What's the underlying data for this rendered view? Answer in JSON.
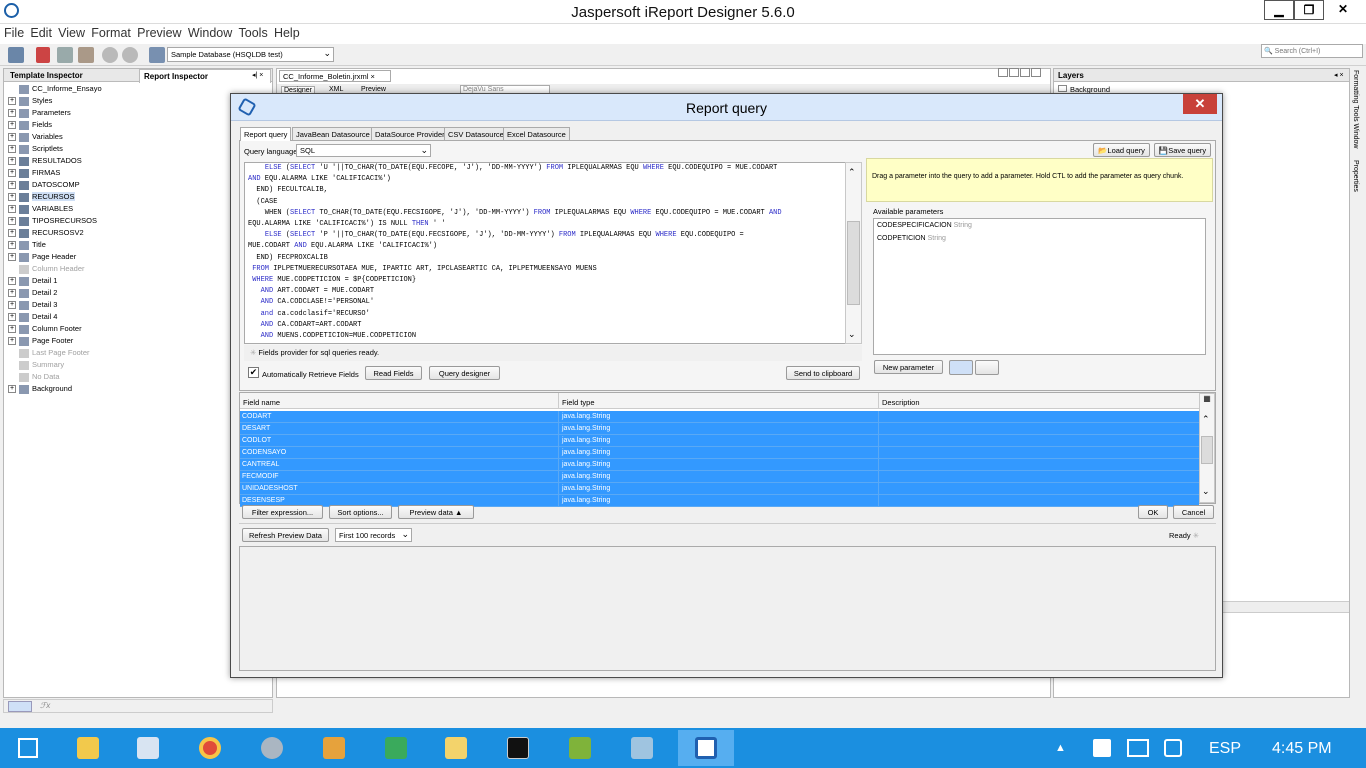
{
  "window": {
    "title": "Jaspersoft iReport Designer 5.6.0"
  },
  "menu": [
    "File",
    "Edit",
    "View",
    "Format",
    "Preview",
    "Window",
    "Tools",
    "Help"
  ],
  "toolbar": {
    "datasource": "Sample Database (HSQLDB test)",
    "search_placeholder": "Search (Ctrl+I)"
  },
  "left_panel": {
    "tabs": [
      "Template Inspector",
      "Report Inspector"
    ],
    "tree": [
      {
        "label": "CC_Informe_Ensayo",
        "dim": false
      },
      {
        "label": "Styles",
        "dim": false
      },
      {
        "label": "Parameters",
        "dim": false
      },
      {
        "label": "Fields",
        "dim": false
      },
      {
        "label": "Variables",
        "dim": false
      },
      {
        "label": "Scriptlets",
        "dim": false
      },
      {
        "label": "RESULTADOS",
        "dim": false
      },
      {
        "label": "FIRMAS",
        "dim": false
      },
      {
        "label": "DATOSCOMP",
        "dim": false
      },
      {
        "label": "RECURSOS",
        "dim": false
      },
      {
        "label": "VARIABLES",
        "dim": false
      },
      {
        "label": "TIPOSRECURSOS",
        "dim": false
      },
      {
        "label": "RECURSOSV2",
        "dim": false
      },
      {
        "label": "Title",
        "dim": false
      },
      {
        "label": "Page Header",
        "dim": false
      },
      {
        "label": "Column Header",
        "dim": true
      },
      {
        "label": "Detail 1",
        "dim": false
      },
      {
        "label": "Detail 2",
        "dim": false
      },
      {
        "label": "Detail 3",
        "dim": false
      },
      {
        "label": "Detail 4",
        "dim": false
      },
      {
        "label": "Column Footer",
        "dim": false
      },
      {
        "label": "Page Footer",
        "dim": false
      },
      {
        "label": "Last Page Footer",
        "dim": true
      },
      {
        "label": "Summary",
        "dim": true
      },
      {
        "label": "No Data",
        "dim": true
      },
      {
        "label": "Background",
        "dim": false
      }
    ]
  },
  "editor": {
    "file_tab": "CC_Informe_Boletin.jrxml",
    "view_tabs": [
      "Designer",
      "XML",
      "Preview"
    ],
    "font": "DejaVu Sans"
  },
  "right_panel": {
    "title": "Layers",
    "item": "Background"
  },
  "side_labels": [
    "Formatting Tools Window",
    "Properties"
  ],
  "dialog": {
    "title": "Report query",
    "tabs": [
      "Report query",
      "JavaBean Datasource",
      "DataSource Provider",
      "CSV Datasource",
      "Excel Datasource"
    ],
    "query_language_label": "Query language",
    "query_language": "SQL",
    "load_query": "Load query",
    "save_query": "Save query",
    "sql_lines": [
      "    ELSE (SELECT 'U '||TO_CHAR(TO_DATE(EQU.FECOPE, 'J'), 'DD-MM-YYYY') FROM IPLEQUALARMAS EQU WHERE EQU.CODEQUIPO = MUE.CODART",
      "AND EQU.ALARMA LIKE 'CALIFICACI%')",
      "  END) FECULTCALIB,",
      "  (CASE",
      "    WHEN (SELECT TO_CHAR(TO_DATE(EQU.FECSIGOPE, 'J'), 'DD-MM-YYYY') FROM IPLEQUALARMAS EQU WHERE EQU.CODEQUIPO = MUE.CODART AND",
      "EQU.ALARMA LIKE 'CALIFICACI%') IS NULL THEN ' '",
      "    ELSE (SELECT 'P '||TO_CHAR(TO_DATE(EQU.FECSIGOPE, 'J'), 'DD-MM-YYYY') FROM IPLEQUALARMAS EQU WHERE EQU.CODEQUIPO =",
      "MUE.CODART AND EQU.ALARMA LIKE 'CALIFICACI%')",
      "  END) FECPROXCALIB",
      " FROM IPLPETMUERECURSOTAEA MUE, IPARTIC ART, IPCLASEARTIC CA, IPLPETMUEENSAYO MUENS",
      " WHERE MUE.CODPETICION = $P{CODPETICION}",
      "   AND ART.CODART = MUE.CODART",
      "   AND CA.CODCLASE!='PERSONAL'",
      "   and ca.codclasif='RECURSO'",
      "   AND CA.CODART=ART.CODART",
      "   AND MUENS.CODPETICION=MUE.CODPETICION"
    ],
    "keywords": [
      "ELSE",
      "SELECT",
      "FROM",
      "WHERE",
      "AND",
      "and",
      "THEN"
    ],
    "status": "Fields provider for sql queries ready.",
    "help_text": "Drag a parameter into the query to add a parameter. Hold CTL to add the parameter as query chunk.",
    "available_parameters_label": "Available parameters",
    "parameters": [
      {
        "name": "CODESPECIFICACION",
        "type": "String"
      },
      {
        "name": "CODPETICION",
        "type": "String"
      }
    ],
    "auto_retrieve": "Automatically Retrieve Fields",
    "read_fields": "Read Fields",
    "query_designer": "Query designer",
    "send_clipboard": "Send to clipboard",
    "new_parameter": "New parameter",
    "columns": [
      "Field name",
      "Field type",
      "Description"
    ],
    "fields": [
      {
        "name": "CODART",
        "type": "java.lang.String"
      },
      {
        "name": "DESART",
        "type": "java.lang.String"
      },
      {
        "name": "CODLOT",
        "type": "java.lang.String"
      },
      {
        "name": "CODENSAYO",
        "type": "java.lang.String"
      },
      {
        "name": "CANTREAL",
        "type": "java.lang.String"
      },
      {
        "name": "FECMODIF",
        "type": "java.lang.String"
      },
      {
        "name": "UNIDADESHOST",
        "type": "java.lang.String"
      },
      {
        "name": "DESENSESP",
        "type": "java.lang.String"
      }
    ],
    "filter_expression": "Filter expression...",
    "sort_options": "Sort options...",
    "preview_data": "Preview data",
    "ok": "OK",
    "cancel": "Cancel",
    "refresh_preview": "Refresh Preview Data",
    "records": "First 100 records",
    "ready": "Ready"
  },
  "taskbar": {
    "language": "ESP",
    "time": "4:45 PM"
  },
  "colors": {
    "selection": "#3399ff",
    "taskbar": "#1b8fe0",
    "close": "#c8413a",
    "keyword": "#2c2cc8"
  }
}
